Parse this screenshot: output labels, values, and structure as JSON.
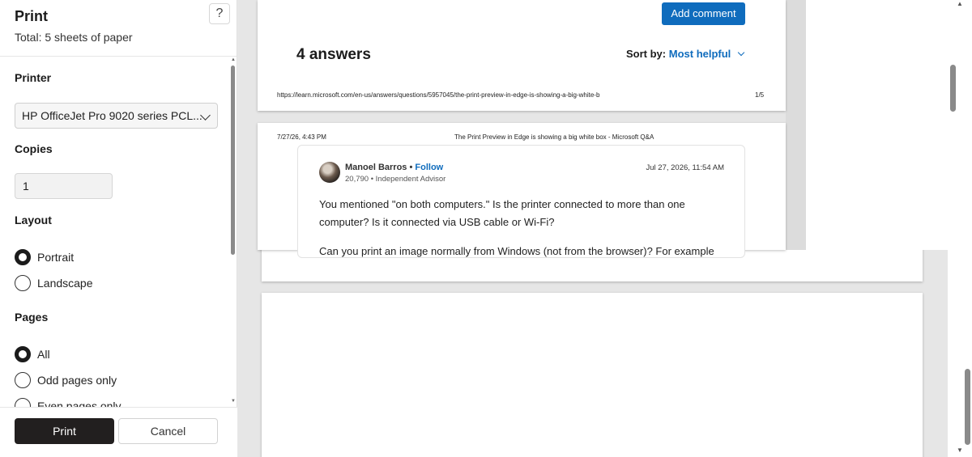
{
  "panel": {
    "title": "Print",
    "subtitle": "Total: 5 sheets of paper",
    "help": "?",
    "printer_label": "Printer",
    "printer_value": "HP OfficeJet Pro 9020 series PCL...",
    "copies_label": "Copies",
    "copies_value": "1",
    "layout_label": "Layout",
    "layout_options": [
      "Portrait",
      "Landscape"
    ],
    "layout_selected": "Portrait",
    "pages_label": "Pages",
    "pages_options": [
      "All",
      "Odd pages only",
      "Even pages only"
    ],
    "pages_selected": "All",
    "print_button": "Print",
    "cancel_button": "Cancel"
  },
  "preview": {
    "page1": {
      "add_comment": "Add comment",
      "answers_heading": "4 answers",
      "sort_by_label": "Sort by:",
      "sort_by_value": "Most helpful",
      "footer_url": "https://learn.microsoft.com/en-us/answers/questions/5957045/the-print-preview-in-edge-is-showing-a-big-white-b",
      "footer_page": "1/5"
    },
    "page2": {
      "header_date": "7/27/26, 4:43 PM",
      "header_title": "The Print Preview in Edge is showing a big white box - Microsoft Q&A",
      "author": "Manoel Barros",
      "separator": " • ",
      "follow": "Follow",
      "reputation": "20,790 • Independent Advisor",
      "answer_date": "Jul 27, 2026, 11:54 AM",
      "text_para1": "You mentioned \"on both computers.\" Is the printer connected to more than one computer? Is it connected via USB cable or Wi-Fi?",
      "text_para2": "Can you print an image normally from Windows (not from the browser)? For example"
    }
  },
  "colors": {
    "accent": "#0f6cbd",
    "print_button": "#221f1f"
  }
}
